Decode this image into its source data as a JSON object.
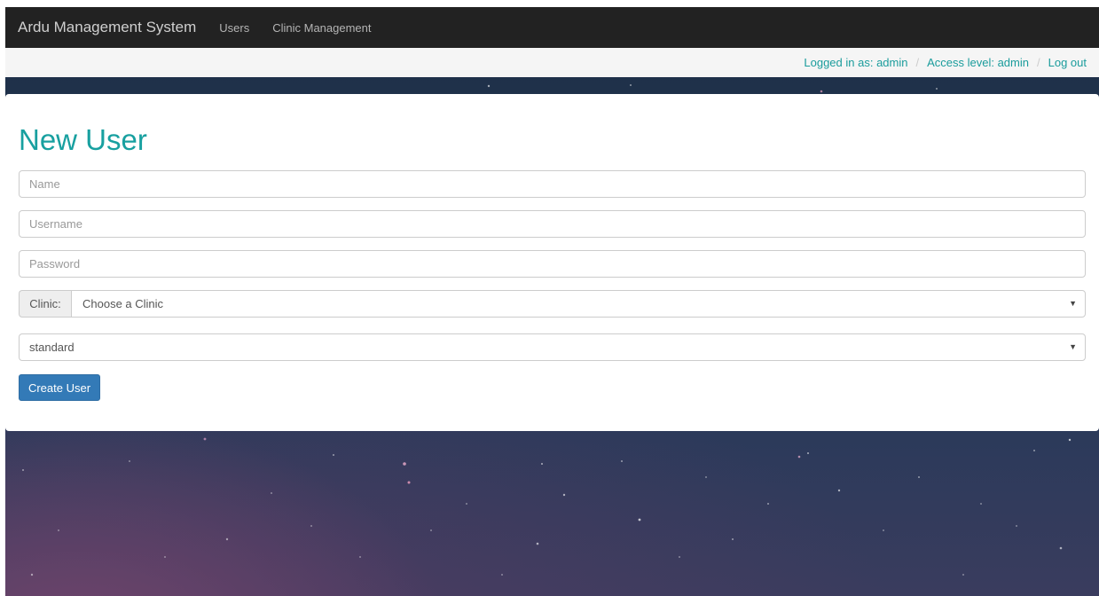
{
  "navbar": {
    "brand": "Ardu Management System",
    "links": [
      "Users",
      "Clinic Management"
    ]
  },
  "breadcrumb": {
    "logged_in": "Logged in as: admin",
    "access_level": "Access level: admin",
    "logout": "Log out",
    "separator": "/"
  },
  "form": {
    "title": "New User",
    "name_placeholder": "Name",
    "username_placeholder": "Username",
    "password_placeholder": "Password",
    "clinic_label": "Clinic:",
    "clinic_selected": "Choose a Clinic",
    "access_level_selected": "standard",
    "submit_label": "Create User"
  },
  "icons": {
    "dropdown": "chevron-down-icon"
  },
  "colors": {
    "navbar_bg": "#222222",
    "accent_teal": "#18a0a0",
    "primary_button": "#337ab7"
  }
}
